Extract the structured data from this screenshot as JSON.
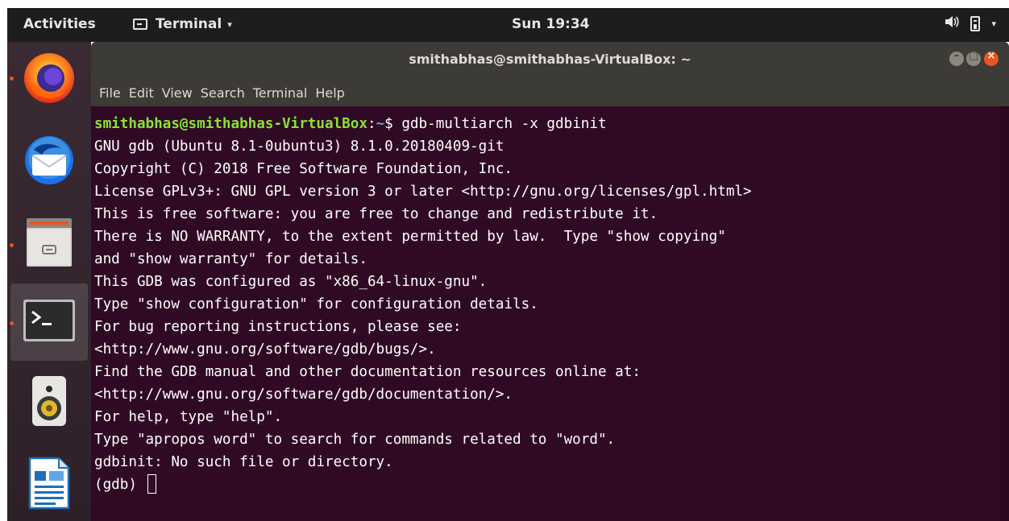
{
  "topbar": {
    "activities": "Activities",
    "app_name": "Terminal",
    "app_caret": "▾",
    "clock": "Sun 19:34",
    "volume_glyph": "🔊",
    "system_caret": "▾"
  },
  "dock": {
    "items": [
      {
        "name": "firefox",
        "running": true,
        "active": false
      },
      {
        "name": "thunderbird",
        "running": false,
        "active": false
      },
      {
        "name": "files",
        "running": true,
        "active": false
      },
      {
        "name": "terminal",
        "running": true,
        "active": true
      },
      {
        "name": "rhythmbox",
        "running": false,
        "active": false
      },
      {
        "name": "libreoffice-writer",
        "running": false,
        "active": false
      }
    ]
  },
  "window": {
    "title": "smithabhas@smithabhas-VirtualBox: ~",
    "buttons": {
      "minimize": "–",
      "maximize": "□",
      "close": "×"
    },
    "menu": [
      "File",
      "Edit",
      "View",
      "Search",
      "Terminal",
      "Help"
    ]
  },
  "terminal": {
    "prompt_user": "smithabhas@smithabhas-VirtualBox",
    "prompt_sep": ":",
    "prompt_path": "~",
    "prompt_dollar": "$ ",
    "command": "gdb-multiarch -x gdbinit",
    "lines": [
      "GNU gdb (Ubuntu 8.1-0ubuntu3) 8.1.0.20180409-git",
      "Copyright (C) 2018 Free Software Foundation, Inc.",
      "License GPLv3+: GNU GPL version 3 or later <http://gnu.org/licenses/gpl.html>",
      "This is free software: you are free to change and redistribute it.",
      "There is NO WARRANTY, to the extent permitted by law.  Type \"show copying\"",
      "and \"show warranty\" for details.",
      "This GDB was configured as \"x86_64-linux-gnu\".",
      "Type \"show configuration\" for configuration details.",
      "For bug reporting instructions, please see:",
      "<http://www.gnu.org/software/gdb/bugs/>.",
      "Find the GDB manual and other documentation resources online at:",
      "<http://www.gnu.org/software/gdb/documentation/>.",
      "For help, type \"help\".",
      "Type \"apropos word\" to search for commands related to \"word\".",
      "gdbinit: No such file or directory."
    ],
    "gdb_prompt": "(gdb) "
  },
  "colors": {
    "terminal_bg": "#300a24",
    "prompt_user": "#8ae234",
    "prompt_path": "#729fcf",
    "accent": "#e95420"
  }
}
